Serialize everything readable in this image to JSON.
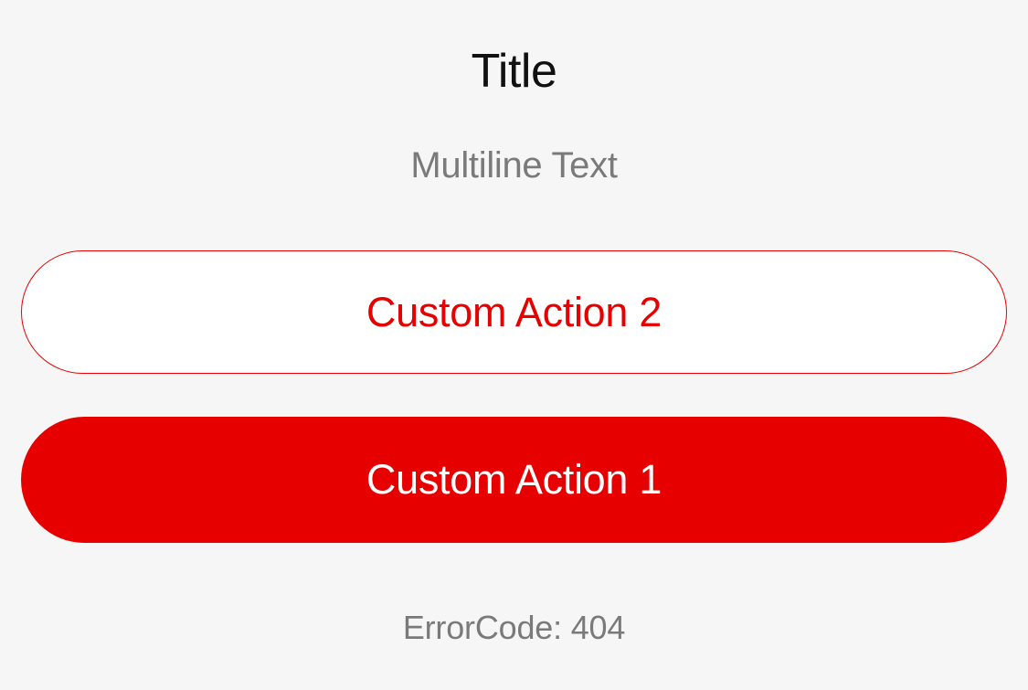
{
  "dialog": {
    "title": "Title",
    "message": "Multiline Text",
    "secondary_action_label": "Custom Action 2",
    "primary_action_label": "Custom Action 1",
    "error_code": "ErrorCode: 404"
  },
  "colors": {
    "background": "#f6f6f6",
    "accent": "#e60000",
    "title_text": "#111111",
    "secondary_text": "#7a7a7a",
    "button_fill_secondary": "#ffffff",
    "button_text_primary": "#ffffff"
  }
}
